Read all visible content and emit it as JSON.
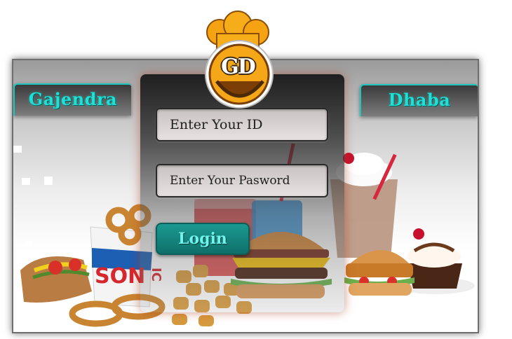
{
  "brand": {
    "left_label": "Gajendra",
    "right_label": "Dhaba",
    "logo_text": "GD",
    "accent_color": "#1ee0d7"
  },
  "login": {
    "id_placeholder": "Enter Your ID",
    "password_placeholder": "Enter Your Pasword",
    "button_label": "Login",
    "button_color": "#12837c"
  },
  "food_image": {
    "cup_text": "SONIC",
    "items": [
      "hot-dog",
      "fries-cup",
      "onion-rings",
      "tater-tots",
      "drinks",
      "burger",
      "chicken-sandwich",
      "milkshake",
      "sundae"
    ]
  }
}
